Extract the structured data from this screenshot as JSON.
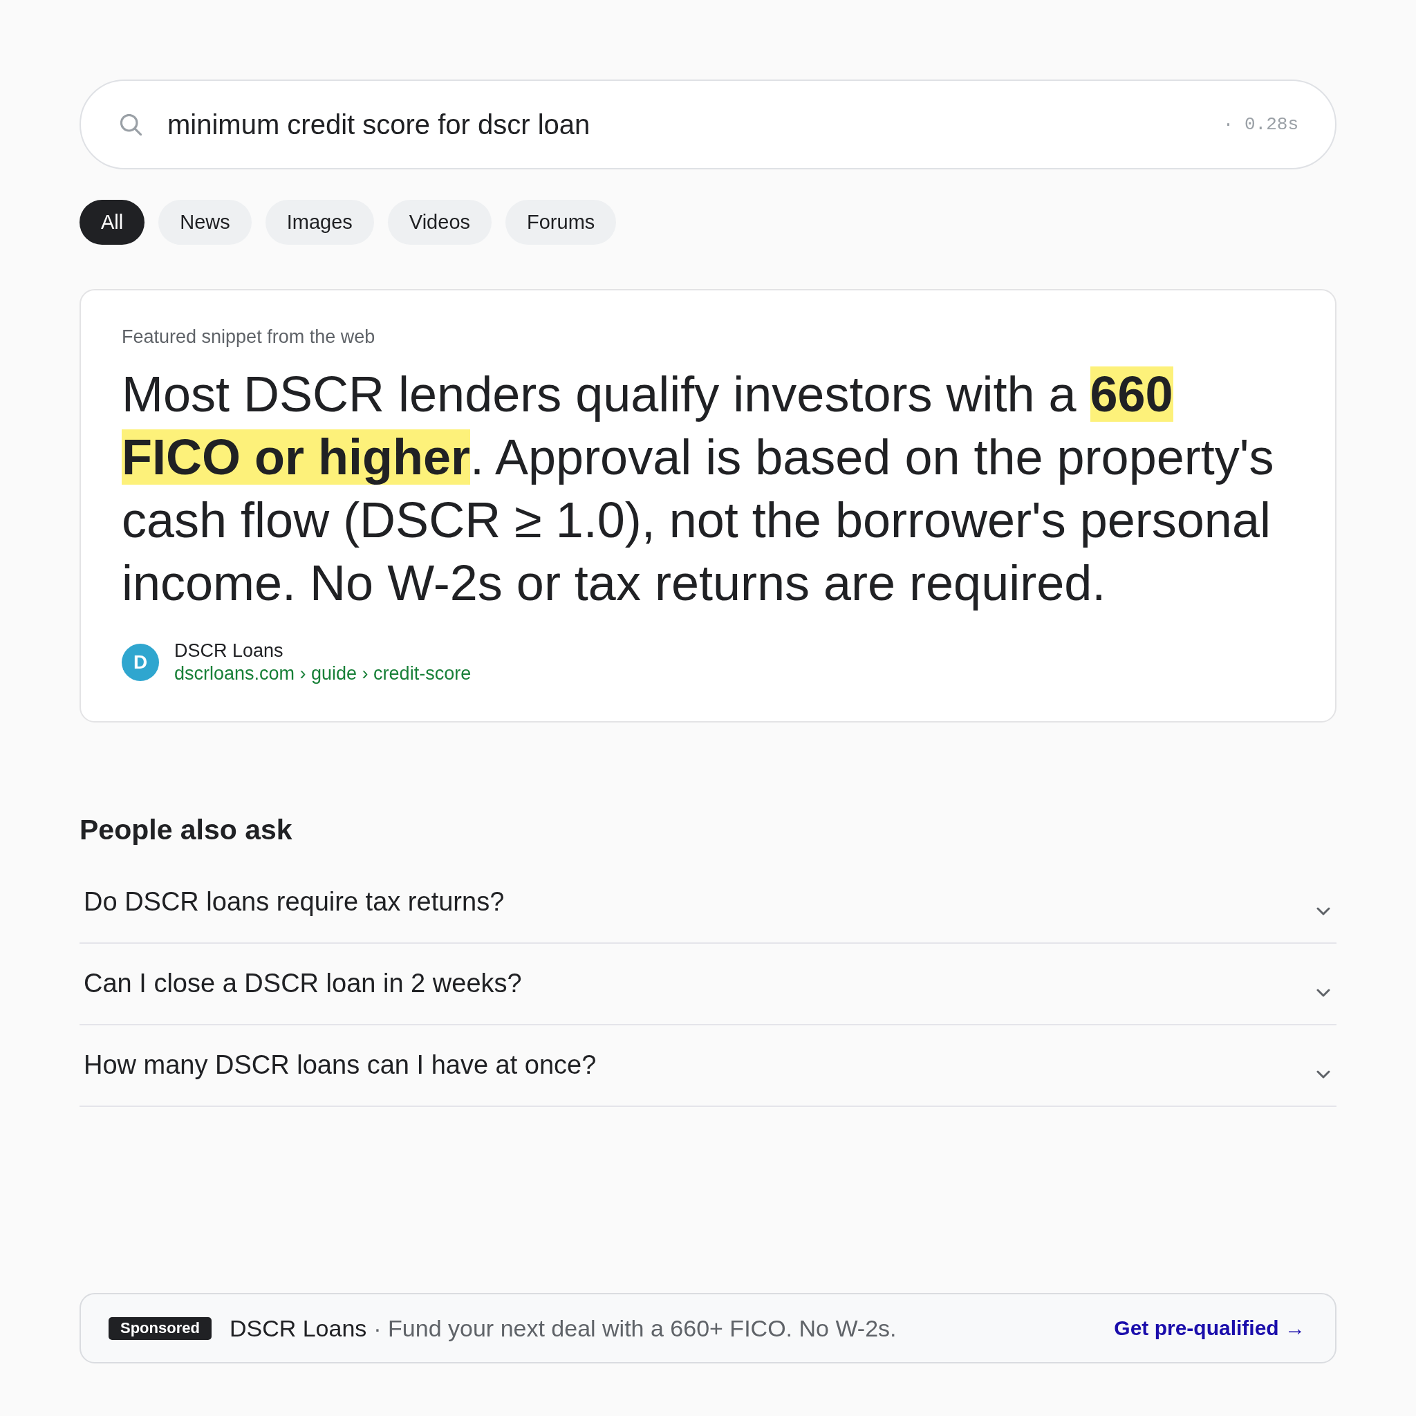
{
  "search": {
    "query": "minimum credit score for dscr loan",
    "timing": "· 0.28s"
  },
  "tabs": [
    {
      "label": "All",
      "selected": true
    },
    {
      "label": "News",
      "selected": false
    },
    {
      "label": "Images",
      "selected": false
    },
    {
      "label": "Videos",
      "selected": false
    },
    {
      "label": "Forums",
      "selected": false
    }
  ],
  "featured_snippet": {
    "label": "Featured snippet from the web",
    "answer": "Most DSCR lenders qualify investors with a **660 FICO or higher**. Approval is based on the property's cash flow (DSCR ≥ 1.0), not the borrower's personal income. No W-2s or tax returns are required.",
    "source": {
      "logo_letter": "D",
      "name": "DSCR Loans",
      "url": "dscrloans.com › guide › credit-score"
    }
  },
  "people_also_ask": {
    "title": "People also ask",
    "questions": [
      {
        "text": "Do DSCR loans require tax returns?",
        "expanded": false
      },
      {
        "text": "Can I close a DSCR loan in 2 weeks?",
        "expanded": false
      },
      {
        "text": "How many DSCR loans can I have at once?",
        "expanded": false
      }
    ]
  },
  "sponsored": {
    "badge": "Sponsored",
    "advertiser": "DSCR Loans",
    "text": "· Fund your next deal with a 660+ FICO. No W-2s.",
    "cta": "Get pre-qualified →"
  }
}
